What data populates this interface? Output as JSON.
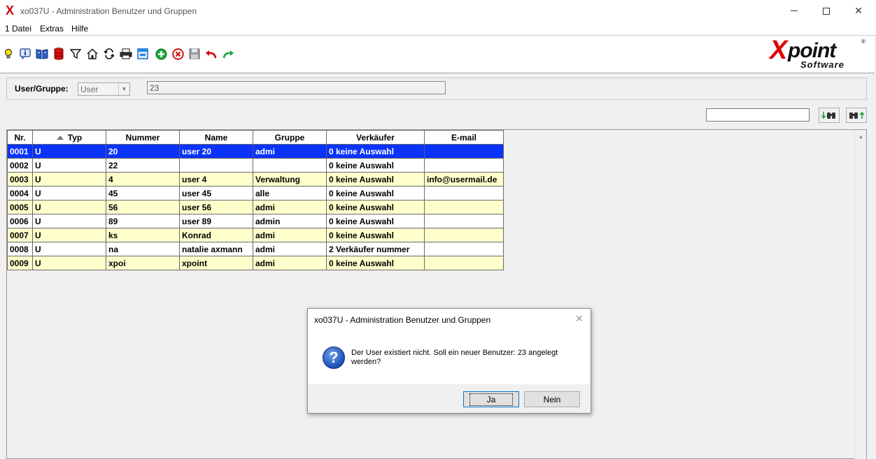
{
  "window": {
    "title": "xo037U - Administration Benutzer und Gruppen",
    "app_icon_glyph": "X",
    "brand_color": "#d10000"
  },
  "menu": {
    "items": [
      "1 Datei",
      "Extras",
      "Hilfe"
    ]
  },
  "toolbar": {
    "icons": [
      "lightbulb-icon",
      "info-icon",
      "book-icon",
      "database-icon",
      "filter-icon",
      "home-icon",
      "refresh-icon",
      "print-icon",
      "window-icon",
      "add-icon",
      "delete-icon",
      "save-icon",
      "undo-icon",
      "redo-icon"
    ]
  },
  "logo": {
    "main_x": "X",
    "main_rest": "point",
    "sub": "Software",
    "reg": "®"
  },
  "filter": {
    "label": "User/Gruppe:",
    "select_value": "User",
    "input_value": "23"
  },
  "search": {
    "value": "",
    "find_next_icon": "find-down-icon",
    "find_prev_icon": "find-up-icon"
  },
  "grid": {
    "columns": [
      "Nr.",
      "Typ",
      "Nummer",
      "Name",
      "Gruppe",
      "Verkäufer",
      "E-mail"
    ],
    "sorted_column": "Typ",
    "selected_row": 0,
    "selection_color": "#0a33ff",
    "alt_row_color": "#ffffcc",
    "rows": [
      [
        "0001",
        "U",
        "20",
        "user   20",
        "admi",
        "0  keine Auswahl",
        ""
      ],
      [
        "0002",
        "U",
        "22",
        "",
        "",
        "0  keine Auswahl",
        ""
      ],
      [
        "0003",
        "U",
        "4",
        "user 4",
        "Verwaltung",
        "0  keine Auswahl",
        "info@usermail.de"
      ],
      [
        "0004",
        "U",
        "45",
        "user 45",
        "alle",
        "0  keine Auswahl",
        ""
      ],
      [
        "0005",
        "U",
        "56",
        "user 56",
        "admi",
        "0  keine Auswahl",
        ""
      ],
      [
        "0006",
        "U",
        "89",
        "user 89",
        "admin",
        "0  keine Auswahl",
        ""
      ],
      [
        "0007",
        "U",
        "ks",
        "Konrad",
        "admi",
        "0  keine Auswahl",
        ""
      ],
      [
        "0008",
        "U",
        "na",
        "natalie axmann",
        "admi",
        "2  Verkäufer nummer",
        ""
      ],
      [
        "0009",
        "U",
        "xpoi",
        "xpoint",
        "admi",
        "0  keine Auswahl",
        ""
      ]
    ]
  },
  "dialog": {
    "title": "xo037U - Administration Benutzer und Gruppen",
    "message": "Der User existiert nicht. Soll ein neuer Benutzer: 23 angelegt werden?",
    "icon": "question-icon",
    "yes_label": "Ja",
    "no_label": "Nein"
  }
}
